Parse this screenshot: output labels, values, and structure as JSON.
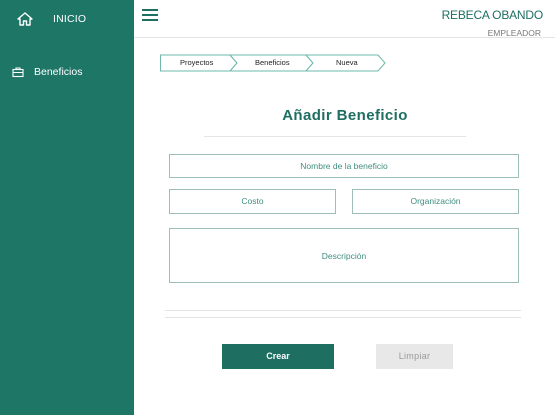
{
  "sidebar": {
    "home": {
      "label": "INICIO",
      "icon": "home-icon"
    },
    "items": [
      {
        "label": "Beneficios",
        "icon": "briefcase-icon"
      }
    ],
    "bg_color": "#1e7667"
  },
  "topbar": {
    "menu_icon": "hamburger-menu-icon",
    "user_name": "REBECA OBANDO",
    "user_role": "EMPLEADOR"
  },
  "breadcrumb": [
    "Proyectos",
    "Beneficios",
    "Nueva"
  ],
  "form": {
    "title": "Añadir Beneficio",
    "name_placeholder": "Nombre de la beneficio",
    "cost_placeholder": "Costo",
    "org_placeholder": "Organización",
    "desc_placeholder": "Descripción"
  },
  "buttons": {
    "create": "Crear",
    "clear": "Limpiar"
  },
  "colors": {
    "accent": "#1e6f62",
    "field_border": "#9dbeb8"
  }
}
